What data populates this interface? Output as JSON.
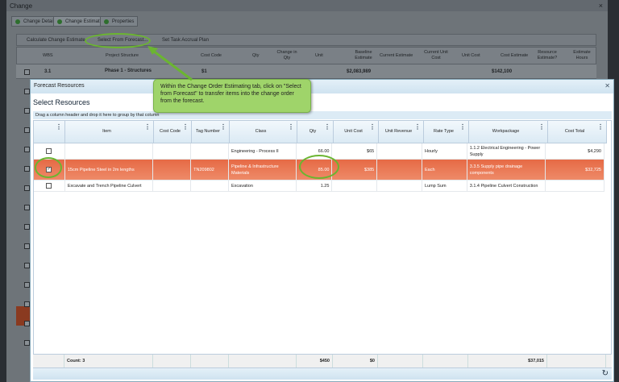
{
  "background_window": {
    "title": "Change",
    "tabs": [
      "Change Detail",
      "Change Estimate",
      "Properties"
    ],
    "active_tab": 1,
    "toolbar": [
      "Calculate Change Estimate",
      "Select From Forecast...",
      "Set Task Accrual Plan"
    ],
    "columns": [
      "WBS",
      "Project Structure",
      "Cost Code",
      "Qty",
      "Change in Qty",
      "Unit",
      "Baseline Estimate",
      "Current Estimate",
      "Current Unit Cost",
      "Unit Cost",
      "Cost Estimate",
      "Resource Estimate?",
      "Estimate Hours"
    ],
    "row": {
      "wbs": "3.1",
      "structure": "Phase 1 - Structures",
      "cost_code": "$1",
      "baseline": "$2,083,989",
      "cost_estimate": "$142,100"
    }
  },
  "callout": {
    "text": "Within the Change Order Estimating tab, click on \"Select from Forecast\" to transfer items into the change order from the forecast."
  },
  "modal": {
    "title": "Forecast Resources",
    "heading": "Select Resources",
    "group_hint": "Drag a column header and drop it here to group by that column",
    "columns": [
      "Item",
      "Cost Code",
      "Tag Number",
      "Class",
      "Qty",
      "Unit Cost",
      "Unit Revenue",
      "Rate Type",
      "Workpackage",
      "Cost Total"
    ],
    "rows": [
      {
        "checked": false,
        "item": "",
        "cost_code": "",
        "tag": "",
        "class": "Engineering - Process II",
        "qty": "66.00",
        "unit_cost": "$65",
        "unit_revenue": "",
        "rate_type": "Hourly",
        "workpackage": "1.1.2 Electrical Engineering - Power Supply",
        "cost_total": "$4,290"
      },
      {
        "checked": true,
        "item": "15cm Pipeline Steel in 2m lengths",
        "cost_code": "",
        "tag": "TN209802",
        "class": "Pipeline & Infrastructure Materials",
        "qty": "85.00",
        "unit_cost": "$385",
        "unit_revenue": "",
        "rate_type": "Each",
        "workpackage": "3.3.5 Supply pipe drainage components",
        "cost_total": "$32,725"
      },
      {
        "checked": false,
        "item": "Excavate and Trench Pipeline Culvert",
        "cost_code": "",
        "tag": "",
        "class": "Excavation",
        "qty": "1.25",
        "unit_cost": "",
        "unit_revenue": "",
        "rate_type": "Lump Sum",
        "workpackage": "3.1.4 Pipeline Culvert Construction",
        "cost_total": ""
      }
    ],
    "footer": {
      "count": "Count: 3",
      "unit_cost": "$450",
      "unit_revenue": "$0",
      "cost_total": "$37,015"
    }
  },
  "colors": {
    "selected_row": "#e66a45",
    "callout": "#9fd46a",
    "highlight": "#6bb531"
  }
}
